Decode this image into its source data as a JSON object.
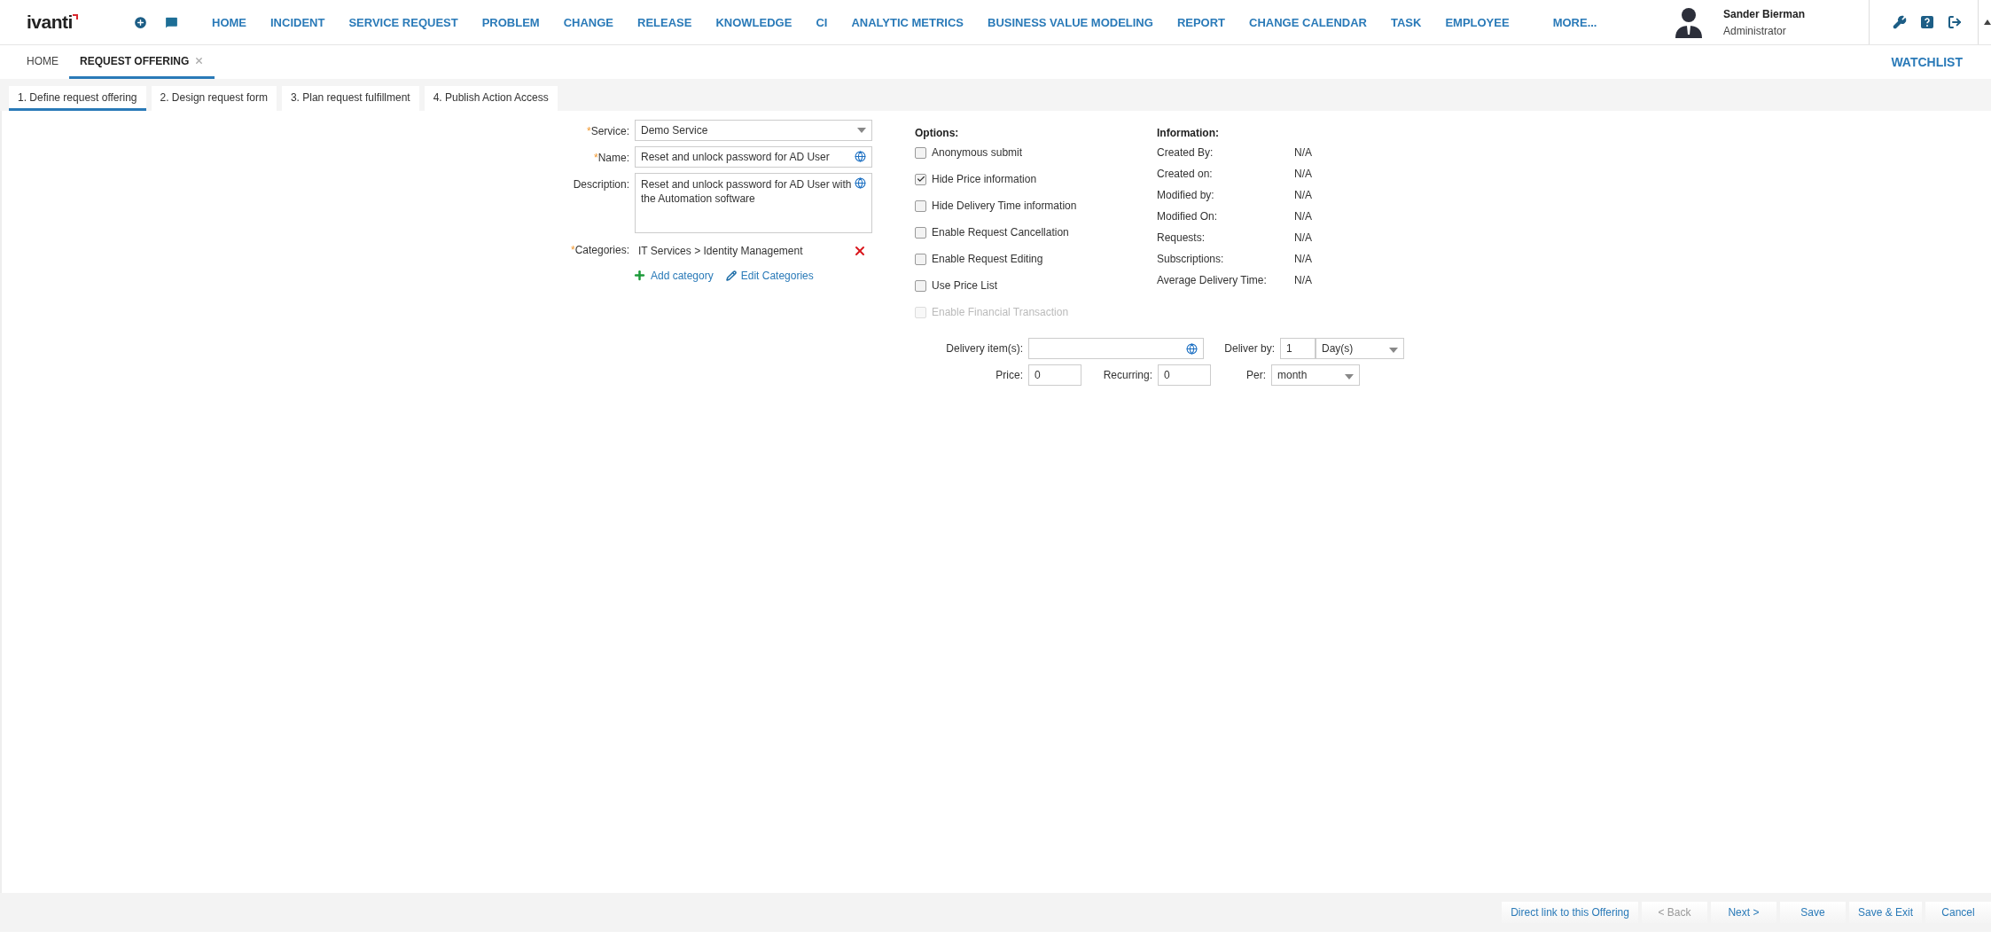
{
  "logo": "ivanti",
  "nav": [
    {
      "label": "HOME"
    },
    {
      "label": "INCIDENT"
    },
    {
      "label": "SERVICE REQUEST"
    },
    {
      "label": "PROBLEM"
    },
    {
      "label": "CHANGE"
    },
    {
      "label": "RELEASE"
    },
    {
      "label": "KNOWLEDGE"
    },
    {
      "label": "CI"
    },
    {
      "label": "ANALYTIC METRICS"
    },
    {
      "label": "BUSINESS VALUE MODELING"
    },
    {
      "label": "REPORT"
    },
    {
      "label": "CHANGE CALENDAR"
    },
    {
      "label": "TASK"
    },
    {
      "label": "EMPLOYEE"
    }
  ],
  "nav_more": "MORE...",
  "user": {
    "name": "Sander Bierman",
    "role": "Administrator"
  },
  "tabs": [
    {
      "label": "HOME",
      "selected": false,
      "closable": false
    },
    {
      "label": "REQUEST OFFERING",
      "selected": true,
      "closable": true
    }
  ],
  "watchlist": "WATCHLIST",
  "steps": [
    {
      "label": "1. Define request offering",
      "selected": true
    },
    {
      "label": "2. Design request form",
      "selected": false
    },
    {
      "label": "3. Plan request fulfillment",
      "selected": false
    },
    {
      "label": "4. Publish Action Access",
      "selected": false
    }
  ],
  "form": [
    {
      "kind": "select",
      "marker": "*",
      "label": "Service:",
      "value": "Demo Service"
    },
    {
      "kind": "text",
      "marker": "*",
      "label": "Name:",
      "value": "Reset and unlock password for AD User"
    },
    {
      "kind": "textarea",
      "label": "Description:",
      "value": "Reset and unlock password for AD User with the Automation software"
    },
    {
      "kind": "categories",
      "marker": "*",
      "label": "Categories:",
      "value": "IT Services > Identity Management"
    }
  ],
  "category_actions": {
    "add": "Add category",
    "edit": "Edit Categories"
  },
  "options": {
    "title": "Options:",
    "items": [
      {
        "label": "Anonymous submit",
        "checked": false,
        "disabled": false
      },
      {
        "label": "Hide Price information",
        "checked": true,
        "disabled": false
      },
      {
        "label": "Hide Delivery Time information",
        "checked": false,
        "disabled": false
      },
      {
        "label": "Enable Request Cancellation",
        "checked": false,
        "disabled": false
      },
      {
        "label": "Enable Request Editing",
        "checked": false,
        "disabled": false
      },
      {
        "label": "Use Price List",
        "checked": false,
        "disabled": false
      },
      {
        "label": "Enable Financial Transaction",
        "checked": false,
        "disabled": true
      }
    ]
  },
  "information": {
    "title": "Information:",
    "rows": [
      {
        "label": "Created By:",
        "value": "N/A"
      },
      {
        "label": "Created on:",
        "value": "N/A"
      },
      {
        "label": "Modified by:",
        "value": "N/A"
      },
      {
        "label": "Modified On:",
        "value": "N/A"
      },
      {
        "label": "Requests:",
        "value": "N/A"
      },
      {
        "label": "Subscriptions:",
        "value": "N/A"
      },
      {
        "label": "Average Delivery Time:",
        "value": "N/A"
      }
    ]
  },
  "delivery": {
    "items_label": "Delivery item(s):",
    "deliver_by_label": "Deliver by:",
    "deliver_by_value": "1",
    "deliver_by_unit": "Day(s)",
    "price_label": "Price:",
    "price_value": "0",
    "recurring_label": "Recurring:",
    "recurring_value": "0",
    "per_label": "Per:",
    "per_value": "month"
  },
  "footer_buttons": [
    {
      "label": "Direct link to this Offering",
      "disabled": false
    },
    {
      "label": "< Back",
      "disabled": true
    },
    {
      "label": "Next >",
      "disabled": false
    },
    {
      "label": "Save",
      "disabled": false
    },
    {
      "label": "Save & Exit",
      "disabled": false
    },
    {
      "label": "Cancel",
      "disabled": false
    }
  ]
}
